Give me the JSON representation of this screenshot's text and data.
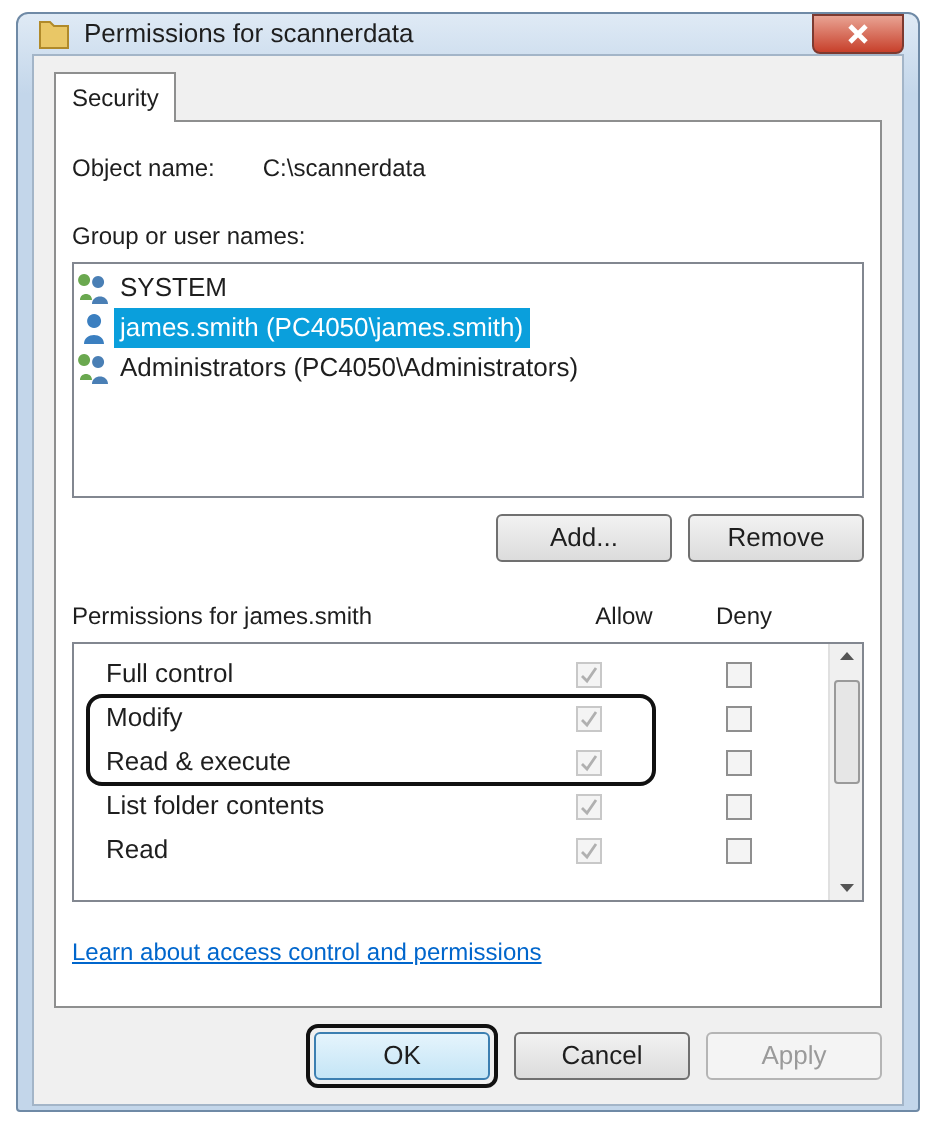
{
  "window": {
    "title": "Permissions for scannerdata"
  },
  "tabs": [
    {
      "label": "Security",
      "selected": true
    }
  ],
  "object_name": {
    "label": "Object name:",
    "value": "C:\\scannerdata"
  },
  "group_label": "Group or user names:",
  "users": [
    {
      "name": "SYSTEM",
      "kind": "group",
      "selected": false
    },
    {
      "name": "james.smith (PC4050\\james.smith)",
      "kind": "user",
      "selected": true
    },
    {
      "name": "Administrators (PC4050\\Administrators)",
      "kind": "group",
      "selected": false
    }
  ],
  "user_buttons": [
    {
      "label": "Add...",
      "disabled": false
    },
    {
      "label": "Remove",
      "disabled": false
    }
  ],
  "permissions_header": {
    "title": "Permissions for  james.smith",
    "allow": "Allow",
    "deny": "Deny"
  },
  "permissions": [
    {
      "name": "Full control",
      "allow": true,
      "deny": false,
      "highlighted": false
    },
    {
      "name": "Modify",
      "allow": true,
      "deny": false,
      "highlighted": true
    },
    {
      "name": "Read & execute",
      "allow": true,
      "deny": false,
      "highlighted": true
    },
    {
      "name": "List folder contents",
      "allow": true,
      "deny": false,
      "highlighted": false
    },
    {
      "name": "Read",
      "allow": true,
      "deny": false,
      "highlighted": false
    }
  ],
  "link": "Learn about access control and permissions",
  "buttons": [
    {
      "label": "OK",
      "disabled": false,
      "highlighted": true
    },
    {
      "label": "Cancel",
      "disabled": false,
      "highlighted": false
    },
    {
      "label": "Apply",
      "disabled": true,
      "highlighted": false
    }
  ]
}
